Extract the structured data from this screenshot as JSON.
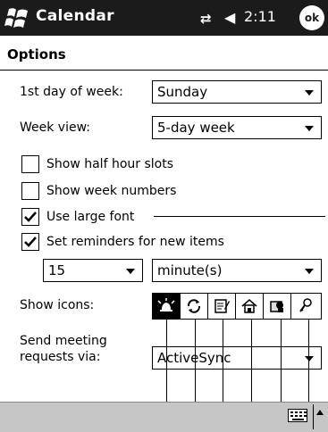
{
  "titlebar": {
    "title": "Calendar",
    "time": "2:11",
    "ok_label": "ok",
    "icons": [
      "windows-start-icon",
      "connectivity-icon",
      "volume-icon"
    ]
  },
  "options": {
    "title": "Options",
    "first_day_label": "1st day of week:",
    "first_day_value": "Sunday",
    "week_view_label": "Week view:",
    "week_view_value": "5-day week",
    "half_hour_label": "Show half hour slots",
    "half_hour_checked": false,
    "week_numbers_label": "Show week numbers",
    "week_numbers_checked": false,
    "large_font_label": "Use large font",
    "large_font_checked": true,
    "reminders_label": "Set reminders for new items",
    "reminders_checked": true,
    "reminder_amount": "15",
    "reminder_unit": "minute(s)",
    "show_icons_label": "Show icons:",
    "icons": [
      "reminder-bell-icon",
      "recurrence-icon",
      "notes-icon",
      "location-icon",
      "private-icon",
      "attendees-icon"
    ],
    "selected_icon": "reminder-bell-icon",
    "meeting_label_line1": "Send meeting",
    "meeting_label_line2": "requests via:",
    "meeting_value": "ActiveSync"
  },
  "bottombar": {
    "icons": [
      "keyboard-icon",
      "sip-arrow-icon"
    ]
  }
}
